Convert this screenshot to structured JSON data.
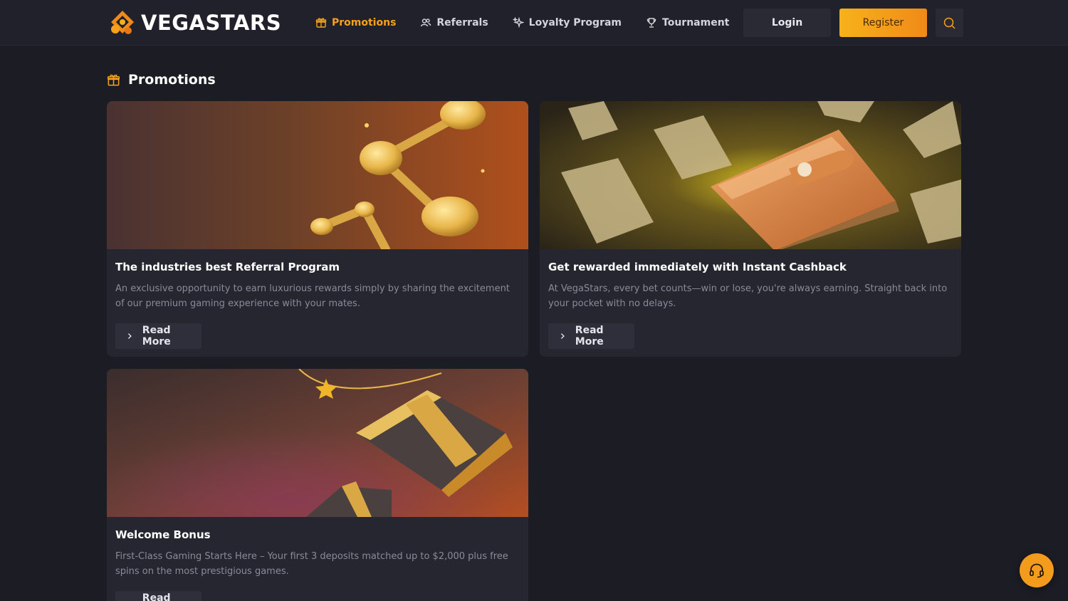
{
  "brand": {
    "name": "VEGASTARS"
  },
  "nav": [
    {
      "label": "Promotions",
      "icon": "gift-icon",
      "active": true
    },
    {
      "label": "Referrals",
      "icon": "users-icon",
      "active": false
    },
    {
      "label": "Loyalty Program",
      "icon": "sparkles-icon",
      "active": false
    },
    {
      "label": "Tournament",
      "icon": "trophy-icon",
      "active": false
    }
  ],
  "auth": {
    "login_label": "Login",
    "register_label": "Register"
  },
  "page": {
    "title": "Promotions"
  },
  "promotions": [
    {
      "title": "The industries best Referral Program",
      "description": "An exclusive opportunity to earn luxurious rewards simply by sharing the excitement of our premium gaming experience with your mates.",
      "cta": "Read More"
    },
    {
      "title": "Get rewarded immediately with Instant Cashback",
      "description": "At VegaStars, every bet counts—win or lose, you're always earning. Straight back into your pocket with no delays.",
      "cta": "Read More"
    },
    {
      "title": "Welcome Bonus",
      "description": "First-Class Gaming Starts Here – Your first 3 deposits matched up to $2,000 plus free spins on the most prestigious games.",
      "cta": "Read More"
    }
  ],
  "colors": {
    "accent": "#f5a11a",
    "background": "#1c1c25",
    "card": "#262631",
    "header": "#21212b"
  }
}
